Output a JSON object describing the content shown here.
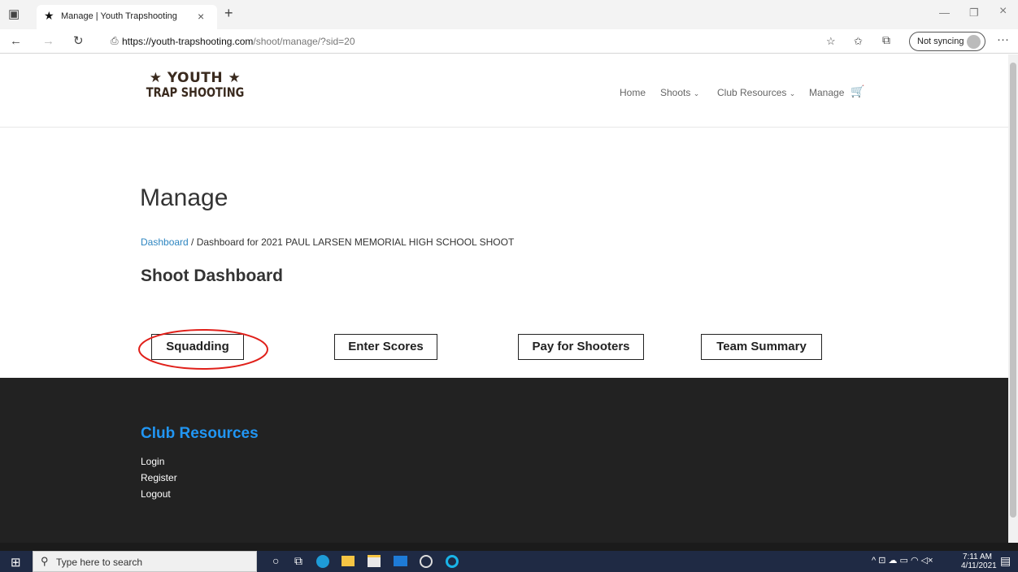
{
  "browser": {
    "tab_title": "Manage | Youth Trapshooting",
    "url_host": "https://youth-trapshooting.com",
    "url_path": "/shoot/manage/?sid=20",
    "sync_label": "Not syncing"
  },
  "site": {
    "logo_line1": "★ YOUTH ★",
    "logo_line2": "TRAP SHOOTING",
    "nav": {
      "home": "Home",
      "shoots": "Shoots",
      "club_resources": "Club Resources",
      "manage": "Manage"
    }
  },
  "main": {
    "title": "Manage",
    "breadcrumb_link": "Dashboard",
    "breadcrumb_rest": " / Dashboard for 2021 PAUL LARSEN MEMORIAL HIGH SCHOOL SHOOT",
    "section_title": "Shoot Dashboard",
    "buttons": {
      "squadding": "Squadding",
      "enter_scores": "Enter Scores",
      "pay_for_shooters": "Pay for Shooters",
      "team_summary": "Team Summary"
    }
  },
  "footer": {
    "heading": "Club Resources",
    "links": [
      "Login",
      "Register",
      "Logout"
    ]
  },
  "taskbar": {
    "search_placeholder": "Type here to search",
    "time": "7:11 AM",
    "date": "4/11/2021"
  },
  "colors": {
    "link": "#2e86c1",
    "footer_heading": "#2196f3",
    "footer_bg": "#222222",
    "highlight_circle": "#e0201a"
  }
}
